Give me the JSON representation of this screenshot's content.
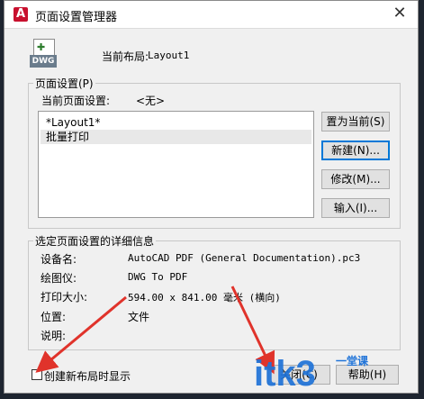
{
  "titlebar": {
    "title": "页面设置管理器",
    "close_glyph": "✕",
    "app_icon_letter": "A"
  },
  "current_layout": {
    "icon_label": "DWG",
    "label": "当前布局:",
    "value": "Layout1"
  },
  "page_setups": {
    "group_title": "页面设置(P)",
    "current_label": "当前页面设置:",
    "current_value": "<无>",
    "items": [
      "*Layout1*",
      "批量打印"
    ],
    "selected_index": 1
  },
  "buttons": {
    "set_current": "置为当前(S)",
    "new": "新建(N)...",
    "modify": "修改(M)...",
    "import": "输入(I)...",
    "close": "关闭(C)",
    "help": "帮助(H)"
  },
  "details": {
    "group_title": "选定页面设置的详细信息",
    "device_label": "设备名:",
    "device_value": "AutoCAD PDF (General Documentation).pc3",
    "plotter_label": "绘图仪:",
    "plotter_value": "DWG To PDF",
    "size_label": "打印大小:",
    "size_value": "594.00 x 841.00 毫米 (横向)",
    "location_label": "位置:",
    "location_value": "文件",
    "description_label": "说明:",
    "description_value": ""
  },
  "checkbox": {
    "label": "创建新布局时显示",
    "checked": false
  },
  "watermark": {
    "text": "itk3",
    "small_text": "一堂课"
  },
  "colors": {
    "accent": "#0078d7",
    "annotation_arrow": "#e0332b",
    "watermark": "#1f73d8"
  }
}
